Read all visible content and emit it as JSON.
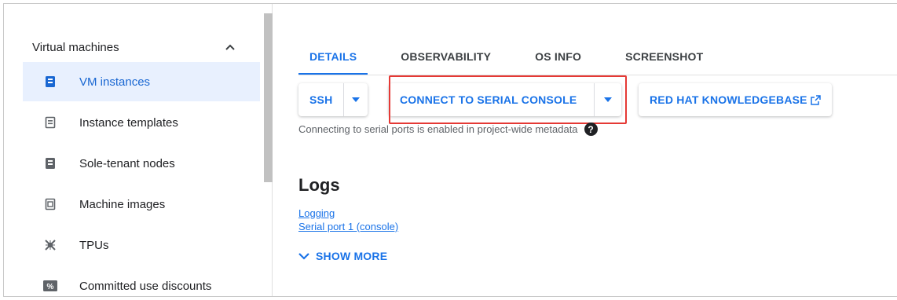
{
  "sidebar": {
    "section_title": "Virtual machines",
    "items": [
      {
        "label": "VM instances",
        "icon": "vm-instance-icon",
        "active": true
      },
      {
        "label": "Instance templates",
        "icon": "instance-template-icon",
        "active": false
      },
      {
        "label": "Sole-tenant nodes",
        "icon": "sole-tenant-icon",
        "active": false
      },
      {
        "label": "Machine images",
        "icon": "machine-image-icon",
        "active": false
      },
      {
        "label": "TPUs",
        "icon": "tpu-icon",
        "active": false
      },
      {
        "label": "Committed use discounts",
        "icon": "percent-icon",
        "active": false
      }
    ]
  },
  "tabs": [
    {
      "label": "DETAILS",
      "active": true
    },
    {
      "label": "OBSERVABILITY",
      "active": false
    },
    {
      "label": "OS INFO",
      "active": false
    },
    {
      "label": "SCREENSHOT",
      "active": false
    }
  ],
  "actions": {
    "ssh_label": "SSH",
    "serial_console_label": "CONNECT TO SERIAL CONSOLE",
    "knowledgebase_label": "RED HAT KNOWLEDGEBASE"
  },
  "serial_note": "Connecting to serial ports is enabled in project-wide metadata",
  "help_glyph": "?",
  "logs": {
    "title": "Logs",
    "links": [
      "Logging",
      "Serial port 1 (console)"
    ],
    "show_more_label": "SHOW MORE"
  },
  "colors": {
    "accent": "#1a73e8",
    "active_nav_bg": "#e8f0fe",
    "highlight_border": "#e53935"
  }
}
